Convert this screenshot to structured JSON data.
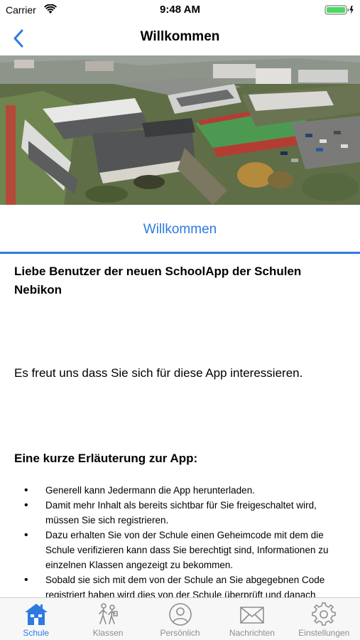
{
  "status": {
    "carrier": "Carrier",
    "time": "9:48 AM"
  },
  "nav": {
    "title": "Willkommen"
  },
  "section": {
    "title": "Willkommen"
  },
  "content": {
    "heading": "Liebe Benutzer der neuen SchoolApp der Schulen Nebikon",
    "intro": "Es freut uns dass Sie sich für diese App interessieren.",
    "explain_heading": "Eine kurze Erläuterung zur App:",
    "bullets": [
      "Generell kann Jedermann die App herunterladen.",
      "Damit mehr Inhalt als bereits sichtbar für Sie freigeschaltet wird, müssen Sie sich registrieren.",
      "Dazu erhalten Sie von der Schule einen Geheimcode mit dem die Schule verifizieren kann dass Sie berechtigt sind, Informationen zu einzelnen Klassen angezeigt zu bekommen.",
      "Sobald sie sich mit dem von der Schule an Sie abgegebnen Code registriert haben wird dies von der Schule überprüft und danach"
    ]
  },
  "tabs": [
    {
      "label": "Schule",
      "icon": "school-icon",
      "active": true
    },
    {
      "label": "Klassen",
      "icon": "students-icon",
      "active": false
    },
    {
      "label": "Persönlich",
      "icon": "person-icon",
      "active": false
    },
    {
      "label": "Nachrichten",
      "icon": "envelope-icon",
      "active": false
    },
    {
      "label": "Einstellungen",
      "icon": "gear-icon",
      "active": false
    }
  ],
  "colors": {
    "accent": "#2d7be0",
    "inactive": "#8e8e93",
    "battery": "#4cd964"
  }
}
